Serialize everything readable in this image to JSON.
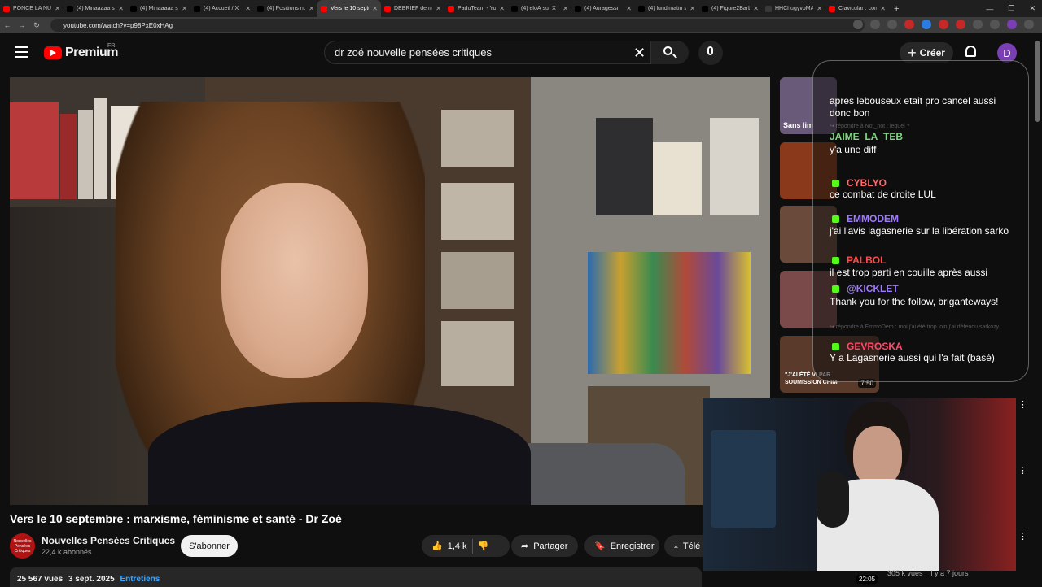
{
  "browser": {
    "tabs": [
      {
        "label": "PONCE LA NUIT",
        "color": "#ff0000"
      },
      {
        "label": "(4) Minaaaaa sur",
        "color": "#000000"
      },
      {
        "label": "(4) Minaaaaa sur",
        "color": "#000000"
      },
      {
        "label": "(4) Accueil / X",
        "color": "#000000"
      },
      {
        "label": "(4) Positions nous",
        "color": "#000000"
      },
      {
        "label": "Vers le 10 septem",
        "color": "#ff0000"
      },
      {
        "label": "DÉBRIEF de mon",
        "color": "#ff0000"
      },
      {
        "label": "PaduTeam - YouT",
        "color": "#ff0000"
      },
      {
        "label": "(4) eloÄ sur X : \"j",
        "color": "#000000"
      },
      {
        "label": "(4) Auragessi",
        "color": "#000000"
      },
      {
        "label": "(4) lundimatin su",
        "color": "#000000"
      },
      {
        "label": "(4) Figure2Barbar",
        "color": "#000000"
      },
      {
        "label": "HHChugyvbMAA",
        "color": "#3a3a3a"
      },
      {
        "label": "Clavicular : comm",
        "color": "#ff0000"
      }
    ],
    "active_tab_index": 5,
    "new_tab": "+",
    "url": "youtube.com/watch?v=p98PxE0xHAg"
  },
  "header": {
    "logo": "Premium",
    "logo_region": "FR",
    "search_value": "dr zoé nouvelle pensées critiques",
    "create_label": "Créer",
    "avatar_letter": "D"
  },
  "video": {
    "title": "Vers le 10 septembre : marxisme, féminisme et santé - Dr Zoé"
  },
  "channel": {
    "avatar_text": "Nouvelles Pensées Critiques",
    "name": "Nouvelles Pensées Critiques",
    "subscribers": "22,4 k abonnés",
    "subscribe_label": "S'abonner"
  },
  "actions": {
    "likes": "1,4 k",
    "share": "Partager",
    "save": "Enregistrer",
    "download": "Télé"
  },
  "meta": {
    "views": "25 567 vues",
    "date": "3 sept. 2025",
    "tag": "Entretiens"
  },
  "recommendations": [
    {
      "overlay": "Sans lim",
      "color": "#6a5a7a"
    },
    {
      "overlay": "",
      "color": "#8a3a1a"
    },
    {
      "overlay": "",
      "color": "#6a4a3a"
    },
    {
      "overlay": "",
      "color": "#7a4a4a"
    },
    {
      "overlay": "\"J'AI ÉTÉ VI PAR SOUMISSION CHIMI",
      "duration": "7:50",
      "color": "#5a3a2a"
    }
  ],
  "rec_last": {
    "duration": "22:05",
    "views": "305 k vues · il y a 7 jours"
  },
  "chat": [
    {
      "type": "text",
      "text": "apres lebouseux etait pro cancel aussi donc bon"
    },
    {
      "type": "ghost",
      "text": "↪ répondre à Not_not : lequel ?"
    },
    {
      "type": "user",
      "name": "JAIME_LA_TEB",
      "color": "#7fd67f"
    },
    {
      "type": "text",
      "text": "y'a une diff"
    },
    {
      "type": "user",
      "name": "CYBLYO",
      "color": "#ff6a6a"
    },
    {
      "type": "text",
      "text": "ce combat de droite LUL"
    },
    {
      "type": "user",
      "name": "EMMODEM",
      "color": "#a07aff"
    },
    {
      "type": "text",
      "text": "j'ai l'avis lagasnerie sur la libération sarko"
    },
    {
      "type": "user",
      "name": "PALBOL",
      "color": "#ff4a4a"
    },
    {
      "type": "text",
      "text": "il est trop parti en couille après aussi"
    },
    {
      "type": "user",
      "name": "@KICKLET",
      "color": "#a07aff"
    },
    {
      "type": "text",
      "text": "Thank you for the follow, briganteways!"
    },
    {
      "type": "ghost",
      "text": "↪ répondre à EmmoDem : moi j'ai été trop loin j'ai défendu sarkozy"
    },
    {
      "type": "user",
      "name": "GEVROSKA",
      "color": "#ff4a6a"
    },
    {
      "type": "text",
      "text": "Y a Lagasnerie aussi qui l'a fait (basé)"
    }
  ]
}
